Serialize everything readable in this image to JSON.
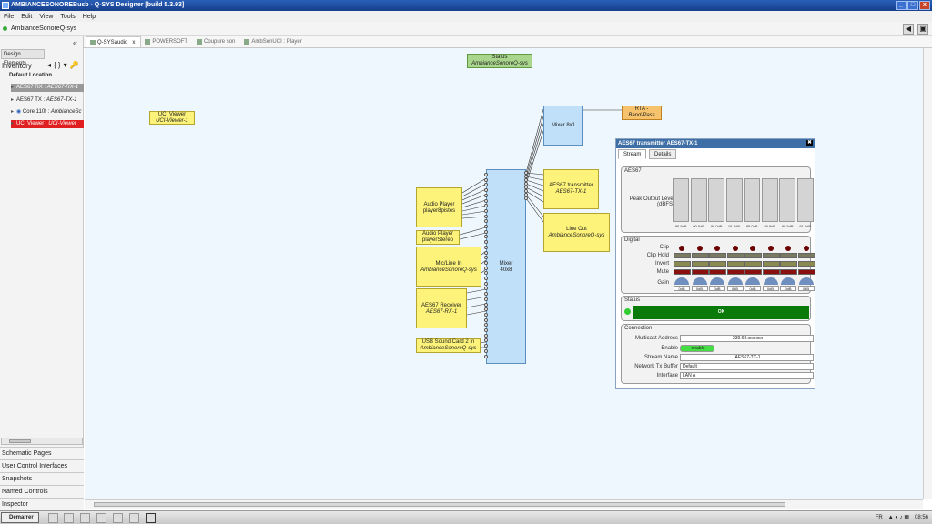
{
  "window": {
    "title": "AMBIANCESONOREBusb - Q-SYS Designer [build 5.3.93]",
    "min": "_",
    "max": "□",
    "close": "x"
  },
  "menu": [
    "File",
    "Edit",
    "View",
    "Tools",
    "Help"
  ],
  "design": {
    "name": "AmbianceSonoreQ-sys"
  },
  "left": {
    "collapse": "«",
    "tab": "Design Elements",
    "inventory": "Inventory",
    "inv_icons": [
      "◂",
      "{ }",
      "▾",
      "🔑"
    ],
    "default_location": "Default Location",
    "tree": [
      {
        "a": "AES67 RX : ",
        "b": "AES67-RX-1"
      },
      {
        "a": "AES67 TX : ",
        "b": "AES67-TX-1"
      },
      {
        "a": "Core 110f : ",
        "b": "AmbianceSc"
      },
      {
        "a": "UCI Viewer : ",
        "b": "UCI-Viewer"
      }
    ],
    "sections": [
      "Schematic Pages",
      "User Control Interfaces",
      "Snapshots",
      "Named Controls",
      "Inspector"
    ]
  },
  "tabs": [
    "Q-SYSaudio",
    "POWERSOFT",
    "Coupure son",
    "AmbSonUCI : Player"
  ],
  "tab_close": "x",
  "blocks": {
    "status": {
      "t": "Status",
      "s": "AmbianceSonoreQ-sys"
    },
    "uci": {
      "t": "UCI Viewer",
      "s": "UCI-Viewer-1"
    },
    "mixer8x1": {
      "t": "Mixer 8x1"
    },
    "rta": {
      "t": "RTA -",
      "s": "Band-Pass"
    },
    "aestx": {
      "t": "AES67 transmitter",
      "s": "AES67-TX-1"
    },
    "lineout": {
      "t": "Line Out",
      "s": "AmbianceSonoreQ-sys"
    },
    "mixer40": {
      "t": "Mixer",
      "s": "40x8"
    },
    "ap8": {
      "t": "Audio Player",
      "s": "player8pistes"
    },
    "apst": {
      "t": "Audio Player",
      "s": "playerStereo"
    },
    "mic": {
      "t": "Mic/Line In",
      "s": "AmbianceSonoreQ-sys"
    },
    "aesrx": {
      "t": "AES67 Receiver",
      "s": "AES67-RX-1"
    },
    "usb": {
      "t": "USB Sound Card 2 In",
      "s": "AmbianceSonoreQ-sys"
    }
  },
  "panel": {
    "title": "AES67 transmitter AES67-TX-1",
    "close": "✖",
    "tabs": [
      "Stream",
      "Details"
    ],
    "g_aes": "AES67",
    "peak_label": "Peak Output Level (dBFS)",
    "peaks": [
      "-86.9dB",
      "-90.5dB",
      "-90.0dB",
      "-91.2dB",
      "-88.0dB",
      "-88.9dB",
      "-90.5dB",
      "-91.5dB"
    ],
    "g_digital": "Digital",
    "rows": [
      "Clip",
      "Clip Hold",
      "Invert",
      "Mute",
      "Gain"
    ],
    "gains": [
      "0dB",
      "0dB",
      "0dB",
      "0dB",
      "0dB",
      "0dB",
      "0dB",
      "0dB"
    ],
    "g_status": "Status",
    "status_ok": "OK",
    "g_conn": "Connection",
    "conn_labels": [
      "Multicast Address",
      "Enable",
      "Stream Name",
      "Network Tx Buffer",
      "Interface"
    ],
    "multicast": "239.69.xxx.xxx",
    "enable": "enable",
    "stream_name": "AES67-TX-1",
    "buffer": "Default",
    "iface": "LAN A",
    "colors": {
      "led": "#6b0000",
      "status": "#0a7a0a",
      "enable": "#44dd44"
    }
  },
  "taskbar": {
    "start": "Démarrer",
    "lang": "FR",
    "time": "08:56"
  }
}
